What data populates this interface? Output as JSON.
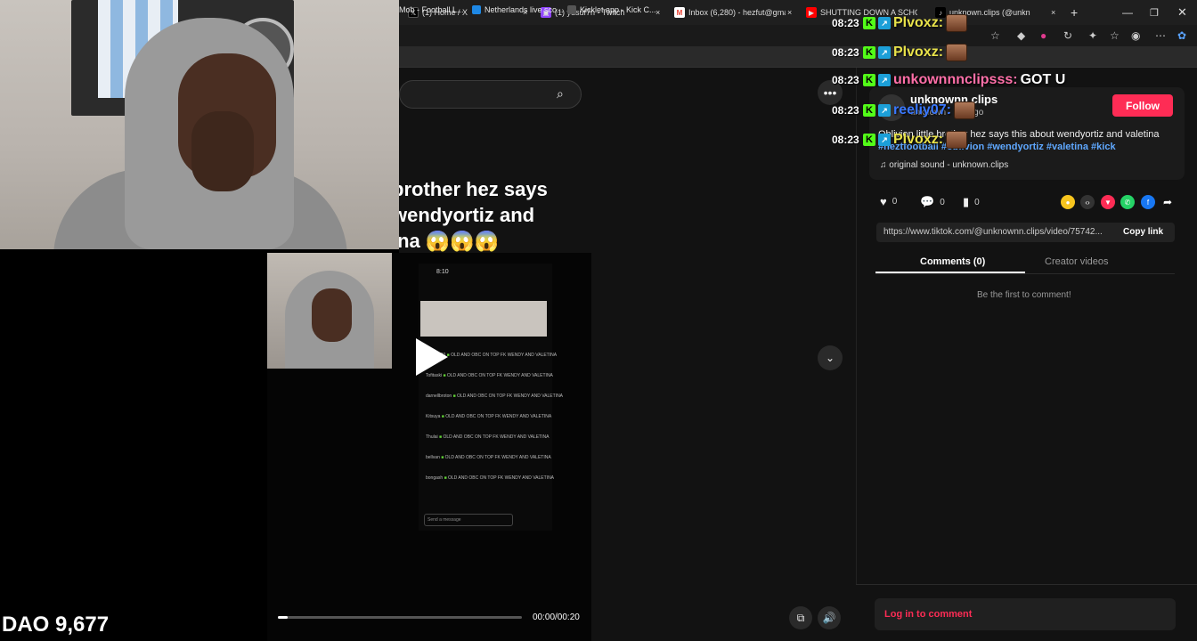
{
  "tabs": [
    {
      "label": "(1) Home / X",
      "icon": "x-logo-icon",
      "color": "#ffffff"
    },
    {
      "label": "(1) yusuf7n - Twitch",
      "icon": "twitch-icon",
      "color": "#9146ff"
    },
    {
      "label": "Inbox (6,280) - hezfut@gma",
      "icon": "gmail-icon",
      "color": "#ea4335"
    },
    {
      "label": "SHUTTING DOWN A SCHO",
      "icon": "youtube-icon",
      "color": "#ff0000"
    },
    {
      "label": "unknown.clips (@unkn",
      "icon": "tiktok-icon",
      "color": "#ffffff"
    }
  ],
  "bookmarks": [
    {
      "label": "Mob - Football L...",
      "color": "#2f7d32"
    },
    {
      "label": "Netherlands live sco...",
      "color": "#1e88e5"
    },
    {
      "label": "Kicklet.app - Kick C...",
      "color": "#444444"
    }
  ],
  "video": {
    "caption_lines": [
      "brother hez says",
      "wendyortiz and",
      "ina 😱😱😱"
    ],
    "time": "00:00/00:20",
    "progress": 0.04,
    "phone_time": "8:10",
    "phone_input_placeholder": "Send a message",
    "phone_chat": [
      {
        "name": "...ers0720",
        "msg": "OLD AND OBC ON TOP FK WENDY AND VALETINA"
      },
      {
        "name": "Tofitaski",
        "msg": "OLD AND OBC ON TOP FK WENDY AND VALETINA"
      },
      {
        "name": "darnellbroton",
        "msg": "OLD AND OBC ON TOP FK WENDY AND VALETINA"
      },
      {
        "name": "Kitsuya",
        "msg": "OLD AND OBC ON TOP FK WENDY AND VALETINA"
      },
      {
        "name": "Thulai",
        "msg": "OLD AND OBC ON TOP FK WENDY AND VALETINA"
      },
      {
        "name": "bellvan",
        "msg": "OLD AND OBC ON TOP FK WENDY AND VALETINA"
      },
      {
        "name": "bongash",
        "msg": "OLD AND OBC ON TOP FK WENDY AND VALETINA"
      }
    ]
  },
  "post": {
    "username": "unknownn.clips",
    "subline": "unknown · 3m ago",
    "follow_label": "Follow",
    "desc_text": "Oblivion little brother hez says this about wendyortiz and valetina",
    "hashtags": [
      "#heztfootball",
      "#oblivion",
      "#wendyortiz",
      "#valetina",
      "#kick"
    ],
    "sound": "original sound - unknown.clips",
    "likes": "0",
    "comments": "0",
    "saves": "0",
    "link": "https://www.tiktok.com/@unknownn.clips/video/75742...",
    "copy_label": "Copy link",
    "tab_comments": "Comments (0)",
    "tab_creator": "Creator videos",
    "empty_text": "Be the first to comment!",
    "login_text": "Log in to comment"
  },
  "chat": [
    {
      "ts": "08:23",
      "name": "Plvoxz:",
      "color": "#e8e24a",
      "msg": "",
      "emote": true
    },
    {
      "ts": "08:23",
      "name": "Plvoxz:",
      "color": "#e8e24a",
      "msg": "",
      "emote": true
    },
    {
      "ts": "08:23",
      "name": "unkownnnclipsss:",
      "color": "#ff6fa8",
      "msg": "GOT U",
      "emote": false
    },
    {
      "ts": "08:23",
      "name": "reeliy07:",
      "color": "#3a78ff",
      "msg": "",
      "emote": true
    },
    {
      "ts": "08:23",
      "name": "Plvoxz:",
      "color": "#e8e24a",
      "msg": "",
      "emote": true
    }
  ],
  "overlay": {
    "dao": "DAO 9,677"
  }
}
